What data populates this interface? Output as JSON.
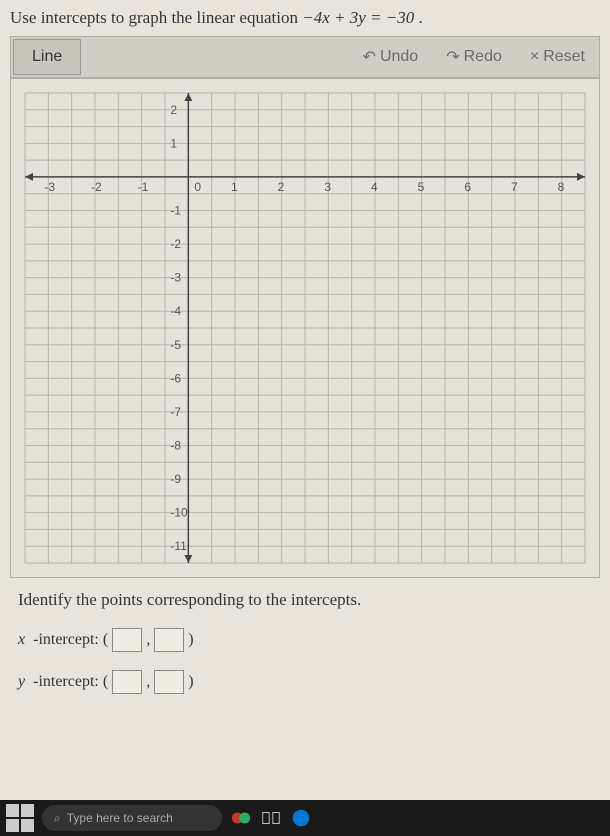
{
  "instruction_prefix": "Use intercepts to graph the linear equation ",
  "equation": "−4x + 3y = −30",
  "instruction_suffix": " .",
  "toolbar": {
    "line": "Line",
    "undo": "Undo",
    "redo": "Redo",
    "reset": "Reset"
  },
  "chart_data": {
    "type": "coordinate-grid",
    "x_ticks": [
      -3,
      -2,
      -1,
      0,
      1,
      2,
      3,
      4,
      5,
      6,
      7,
      8
    ],
    "y_ticks": [
      2,
      1,
      0,
      -1,
      -2,
      -3,
      -4,
      -5,
      -6,
      -7,
      -8,
      -9,
      -10,
      -11
    ],
    "xrange": [
      -3.5,
      8.5
    ],
    "yrange": [
      -11.5,
      2.5
    ],
    "grid_step": 0.5,
    "title": "",
    "series": []
  },
  "identify_text": "Identify the points corresponding to the intercepts.",
  "x_label": "x",
  "y_label": "y",
  "intercept_word": "-intercept:",
  "paren_open": "(",
  "paren_mid": ",",
  "paren_close": ")",
  "search_placeholder": "Type here to search"
}
